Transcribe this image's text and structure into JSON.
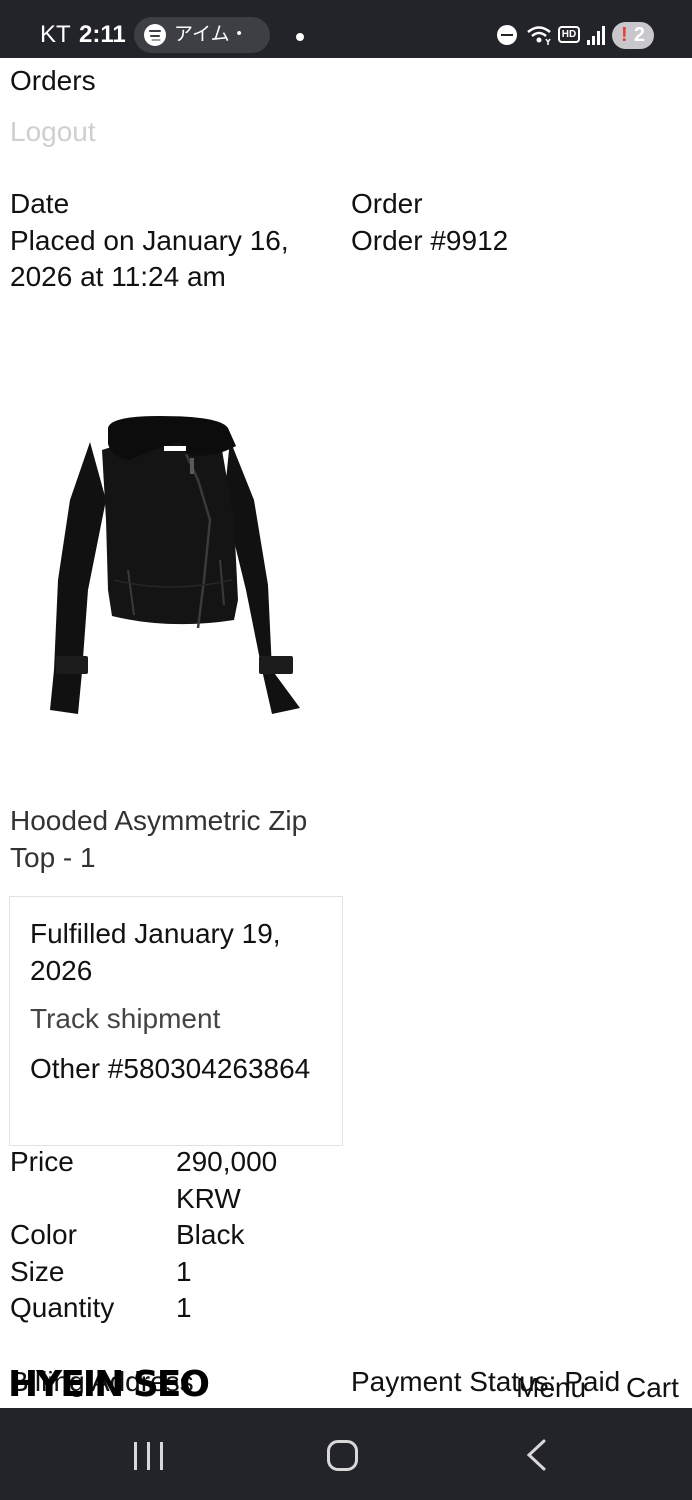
{
  "status_bar": {
    "carrier": "KT",
    "time": "2:11",
    "app_label": "アイム・",
    "hd_label": "HD",
    "notification_count": "2",
    "notification_mark": "!"
  },
  "nav": {
    "orders_label": "Orders",
    "logout_label": "Logout"
  },
  "order": {
    "date_heading": "Date",
    "date_value": "Placed on January 16, 2026 at 11:24 am",
    "order_heading": "Order",
    "order_value": "Order #9912"
  },
  "item": {
    "title": "Hooded Asymmetric Zip Top - 1",
    "fulfillment": {
      "status": "Fulfilled January 19, 2026",
      "track_label": "Track shipment",
      "carrier_tracking": "Other #580304263864"
    },
    "details": [
      {
        "label": "Price",
        "value": "290,000 KRW"
      },
      {
        "label": "Color",
        "value": "Black"
      },
      {
        "label": "Size",
        "value": "1"
      },
      {
        "label": "Quantity",
        "value": "1"
      }
    ]
  },
  "footer": {
    "billing_text": "Billing Address",
    "payment_status": "Payment Status: Paid",
    "brand_logo": "HYEIN SEO",
    "menu_label": "Menu",
    "cart_label": "Cart",
    "product_brand_tag": "HYEIN SEO"
  },
  "icons": {
    "spotify": "spotify-icon",
    "dnd": "do-not-disturb-icon",
    "wifi": "wifi-icon",
    "signal": "signal-icon",
    "recents": "recents-icon",
    "home": "home-icon",
    "back": "back-icon"
  },
  "colors": {
    "system_bar": "#23242a",
    "muted_link": "#cfcfcf",
    "box_border": "#e2e2e2"
  }
}
